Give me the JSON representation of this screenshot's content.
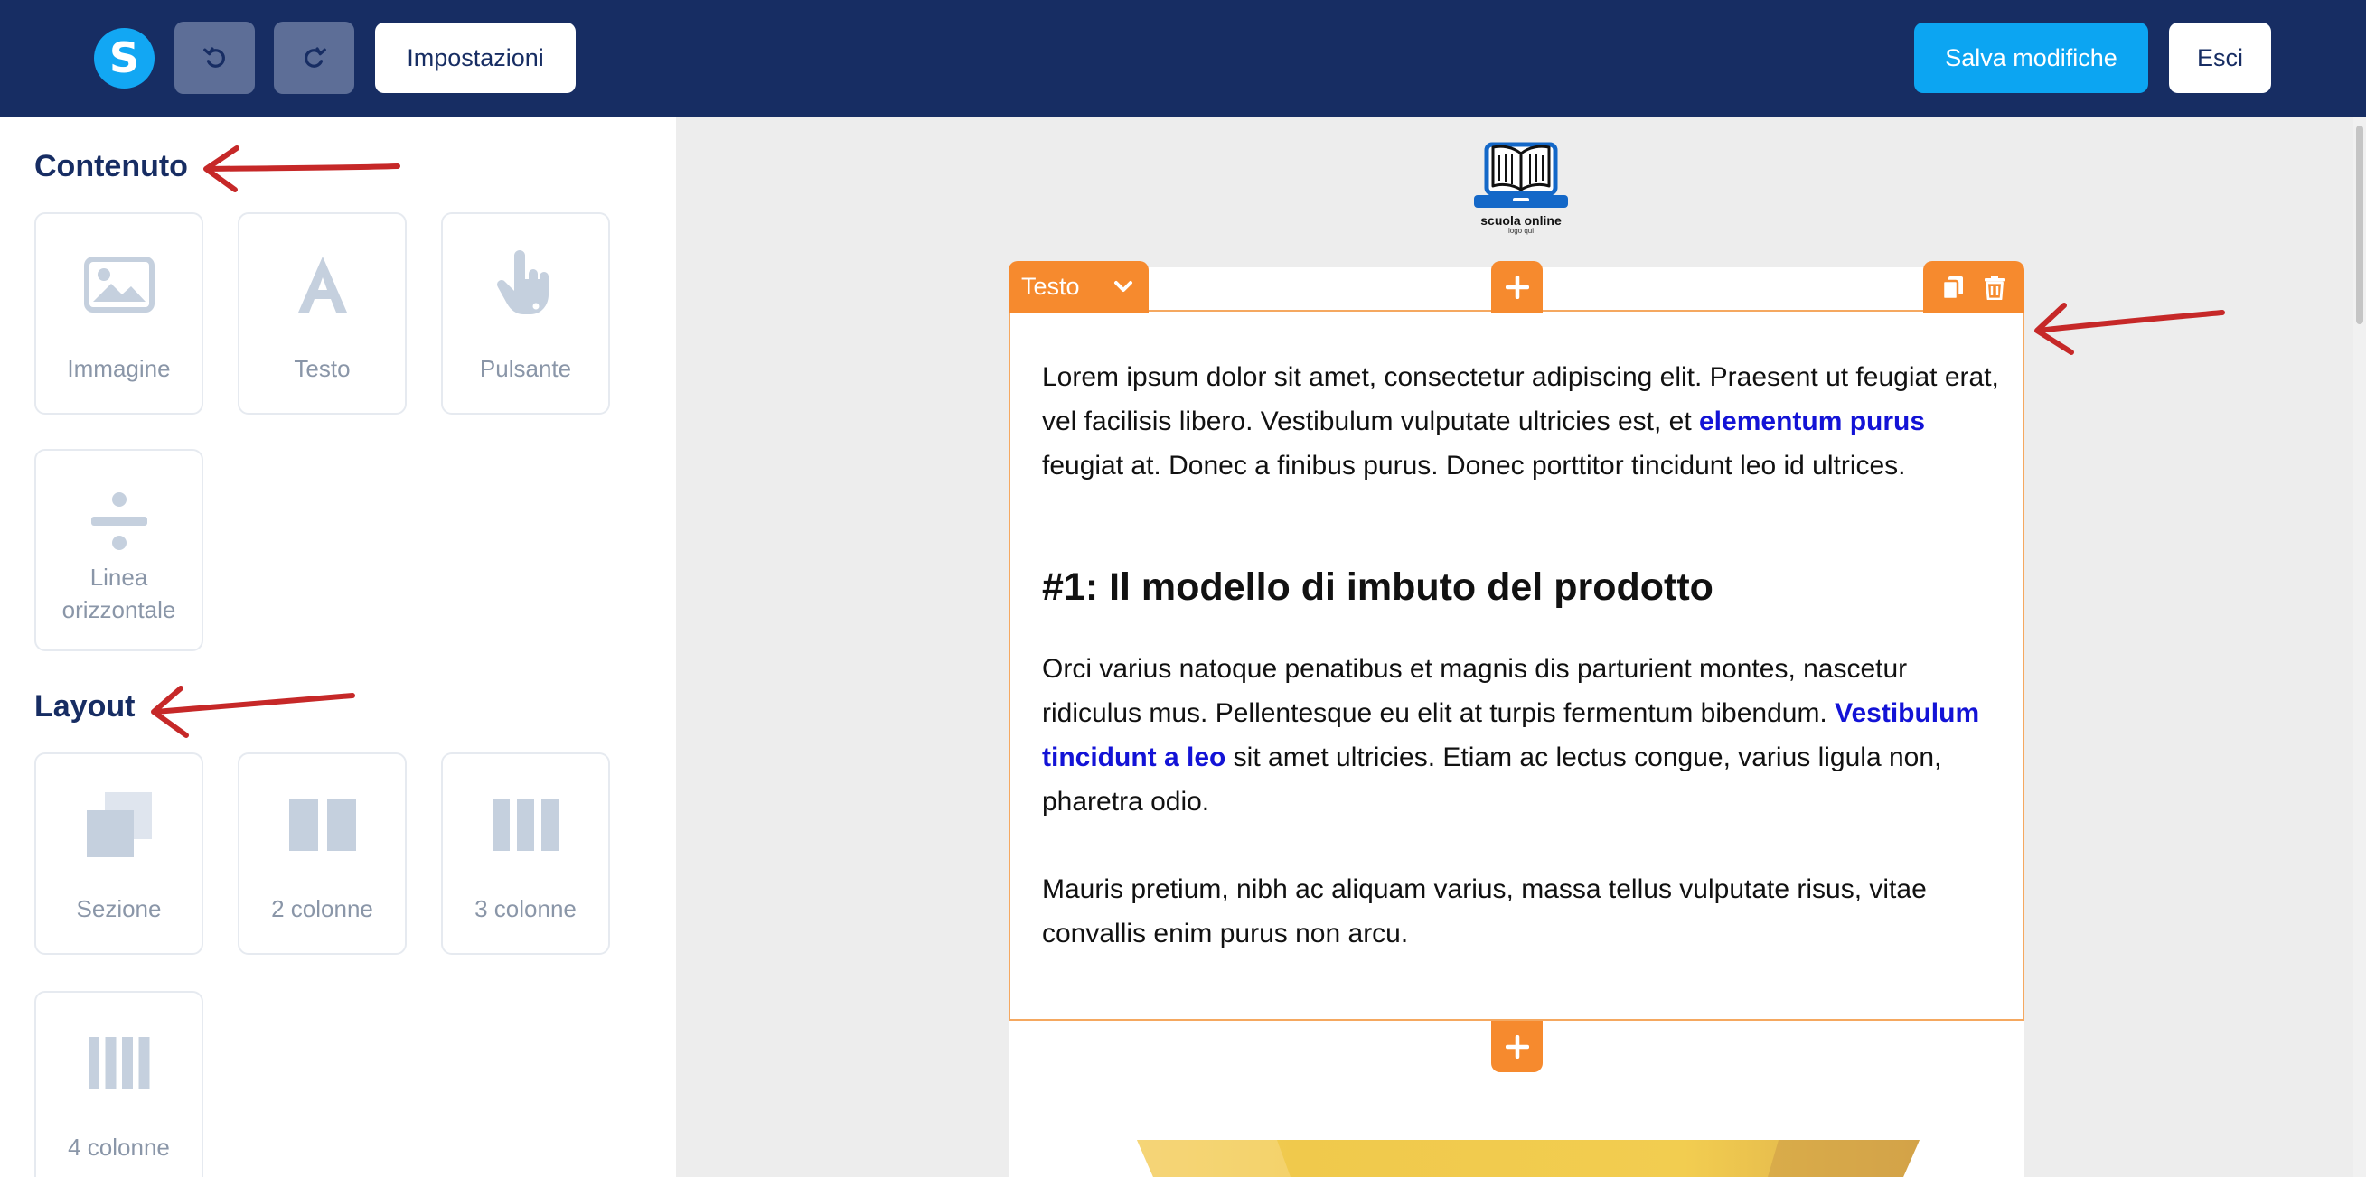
{
  "toolbar": {
    "logo_letter": "S",
    "settings_label": "Impostazioni",
    "save_label": "Salva modifiche",
    "exit_label": "Esci"
  },
  "sidebar": {
    "content_title": "Contenuto",
    "content_items": [
      {
        "label": "Immagine",
        "icon": "image-icon"
      },
      {
        "label": "Testo",
        "icon": "text-icon"
      },
      {
        "label": "Pulsante",
        "icon": "pointer-hand-icon"
      },
      {
        "label": "Linea orizzontale",
        "icon": "divider-icon"
      }
    ],
    "layout_title": "Layout",
    "layout_items": [
      {
        "label": "Sezione",
        "icon": "section-icon"
      },
      {
        "label": "2 colonne",
        "icon": "two-columns-icon"
      },
      {
        "label": "3 colonne",
        "icon": "three-columns-icon"
      },
      {
        "label": "4 colonne",
        "icon": "four-columns-icon"
      }
    ]
  },
  "brand": {
    "name": "scuola online",
    "tagline": "logo qui"
  },
  "block": {
    "type_label": "Testo",
    "accent_color": "#f68a2e",
    "p1_a": "Lorem ipsum dolor sit amet, consectetur adipiscing elit. Praesent ut feugiat erat, vel facilisis libero. Vestibulum vulputate ultricies est, et ",
    "p1_link": "elementum purus",
    "p1_b": " feugiat at. Donec a finibus purus. Donec porttitor tincidunt leo id ultrices.",
    "heading": "#1: Il modello di imbuto del prodotto",
    "p2_a": "Orci varius natoque penatibus et magnis dis parturient montes, nascetur ridiculus mus. Pellentesque eu elit at turpis fermentum bibendum. ",
    "p2_link": "Vestibulum tincidunt a leo",
    "p2_b": " sit amet ultricies. Etiam ac lectus congue, varius ligula non, pharetra odio.",
    "p3": "Mauris pretium, nibh ac aliquam varius, massa tellus vulputate risus, vitae convallis enim purus non arcu."
  },
  "colors": {
    "topbar": "#172d63",
    "primary": "#0ca5f2",
    "link": "#1313d6",
    "annotation_arrow": "#c62828"
  }
}
